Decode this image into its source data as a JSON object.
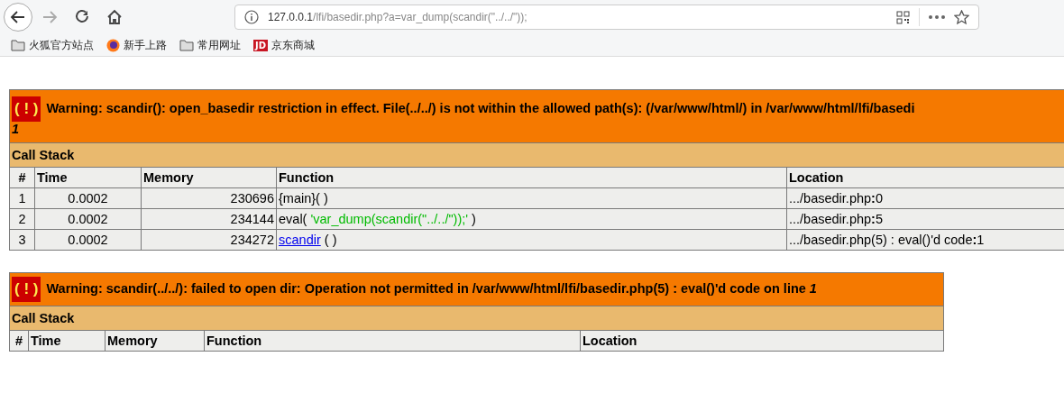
{
  "browser": {
    "url_host": "127.0.0.1",
    "url_rest": "/lfi/basedir.php?a=var_dump(scandir(\"../../\"));",
    "bookmarks": [
      {
        "kind": "folder",
        "label": "火狐官方站点"
      },
      {
        "kind": "firefox",
        "label": "新手上路"
      },
      {
        "kind": "folder",
        "label": "常用网址"
      },
      {
        "kind": "jd",
        "label": "京东商城",
        "badge": "JD"
      }
    ]
  },
  "errors": [
    {
      "icon": "( ! )",
      "message": "Warning: scandir(): open_basedir restriction in effect. File(../../) is not within the allowed path(s): (/var/www/html/) in /var/www/html/lfi/basedi",
      "line": "1",
      "call_stack_title": "Call Stack",
      "columns": [
        "#",
        "Time",
        "Memory",
        "Function",
        "Location"
      ],
      "rows": [
        {
          "num": "1",
          "time": "0.0002",
          "memory": "230696",
          "function": {
            "kind": "plain",
            "name": "{main}",
            "args": "( )"
          },
          "location": {
            "file": ".../basedir.php",
            "sep": ":",
            "line": "0"
          }
        },
        {
          "num": "2",
          "time": "0.0002",
          "memory": "234144",
          "function": {
            "kind": "eval",
            "name": "eval(",
            "arg": "'var_dump(scandir(\"../../\"));'",
            "args": ")"
          },
          "location": {
            "file": ".../basedir.php",
            "sep": ":",
            "line": "5"
          }
        },
        {
          "num": "3",
          "time": "0.0002",
          "memory": "234272",
          "function": {
            "kind": "link",
            "name": "scandir",
            "args": "( )"
          },
          "location": {
            "file": ".../basedir.php(5) : eval()'d code",
            "sep": ":",
            "line": "1"
          }
        }
      ]
    },
    {
      "icon": "( ! )",
      "message": "Warning: scandir(../../): failed to open dir: Operation not permitted in /var/www/html/lfi/basedir.php(5) : eval()'d code on line",
      "line": "1",
      "call_stack_title": "Call Stack",
      "columns": [
        "#",
        "Time",
        "Memory",
        "Function",
        "Location"
      ]
    }
  ]
}
